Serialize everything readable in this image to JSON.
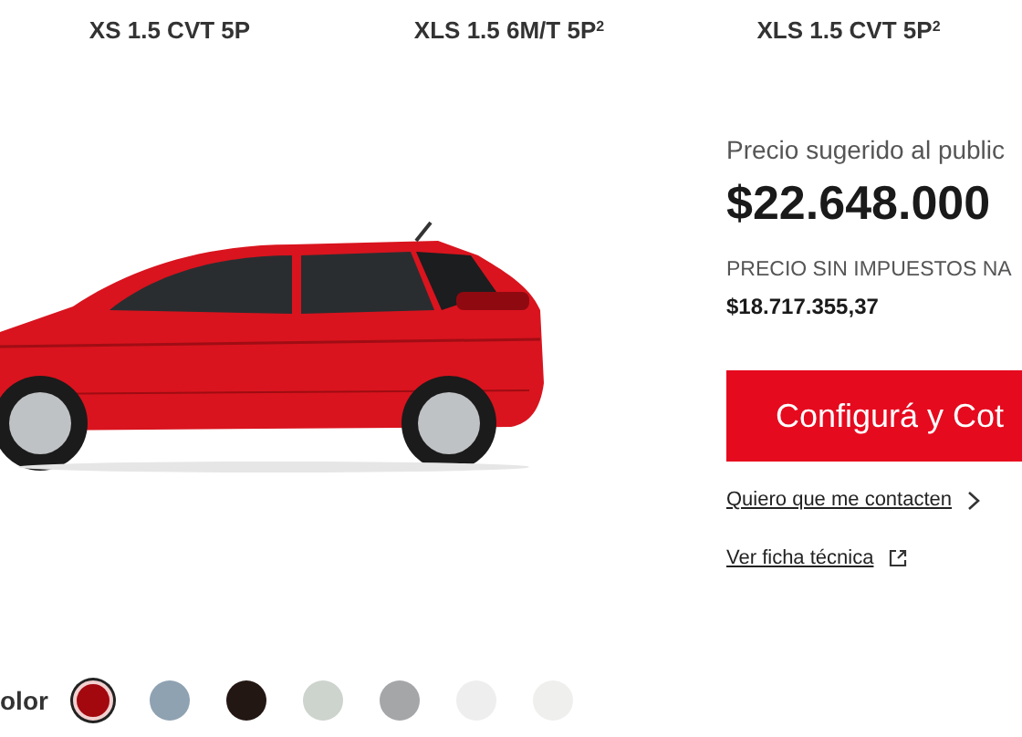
{
  "models": [
    {
      "label": "XS 1.5 CVT 5P"
    },
    {
      "label": "XLS 1.5 6M/T 5P$^{2}$"
    },
    {
      "label": "XLS 1.5 CVT 5P$^{2}$"
    }
  ],
  "price": {
    "label": "Precio sugerido al public",
    "value": "$22.648.000",
    "tax_free_label": "PRECIO SIN IMPUESTOS NA",
    "tax_free_value": "$18.717.355,37"
  },
  "cta": {
    "label": "Configurá y Cot"
  },
  "links": [
    {
      "label": "Quiero que me contacten",
      "kind": "chevron"
    },
    {
      "label": "Ver ficha técnica",
      "kind": "external"
    }
  ],
  "colors": {
    "label": "olor",
    "swatches": [
      {
        "color": "#a3080f",
        "selected": true
      },
      {
        "color": "#8fa2b2",
        "selected": false
      },
      {
        "color": "#231714",
        "selected": false
      },
      {
        "color": "#cdd3cd",
        "selected": false
      },
      {
        "color": "#a5a6a8",
        "selected": false
      },
      {
        "color": "#eeeeee",
        "selected": false
      },
      {
        "color": "#eff0ed",
        "selected": false
      }
    ]
  }
}
